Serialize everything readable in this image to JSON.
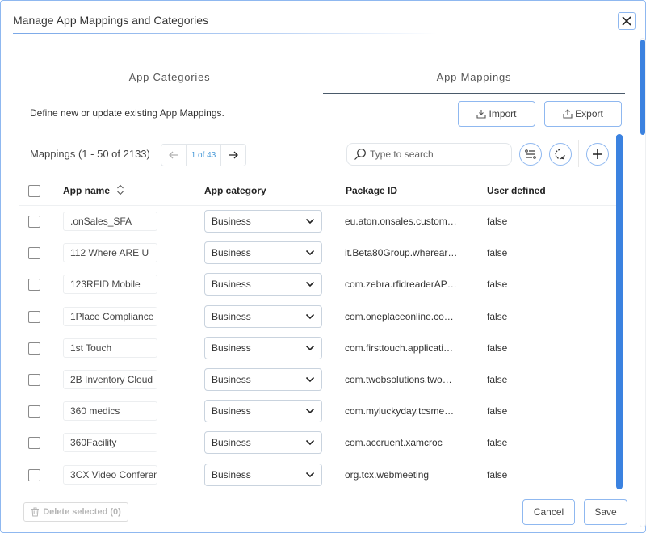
{
  "dialog": {
    "title": "Manage App Mappings and Categories",
    "close_icon": "close-icon"
  },
  "tabs": [
    {
      "label": "App Categories",
      "active": false
    },
    {
      "label": "App Mappings",
      "active": true
    }
  ],
  "description": "Define new or update existing App Mappings.",
  "toolbar": {
    "import_label": "Import",
    "export_label": "Export",
    "mappings_label": "Mappings (1 - 50 of 2133)",
    "page_indicator": "1 of 43",
    "search_placeholder": "Type to search",
    "icons": [
      "filter-icon",
      "refresh-icon",
      "add-icon"
    ]
  },
  "table": {
    "columns": [
      "App name",
      "App category",
      "Package ID",
      "User defined"
    ],
    "rows": [
      {
        "name": ".onSales_SFA",
        "category": "Business",
        "package": "eu.aton.onsales.custom…",
        "user_defined": "false"
      },
      {
        "name": "112 Where ARE U",
        "category": "Business",
        "package": "it.Beta80Group.wherear…",
        "user_defined": "false"
      },
      {
        "name": "123RFID Mobile",
        "category": "Business",
        "package": "com.zebra.rfidreaderAP…",
        "user_defined": "false"
      },
      {
        "name": "1Place Compliance",
        "category": "Business",
        "package": "com.oneplaceonline.co…",
        "user_defined": "false"
      },
      {
        "name": "1st Touch",
        "category": "Business",
        "package": "com.firsttouch.applicati…",
        "user_defined": "false"
      },
      {
        "name": "2B Inventory Cloud",
        "category": "Business",
        "package": "com.twobsolutions.two…",
        "user_defined": "false"
      },
      {
        "name": "360 medics",
        "category": "Business",
        "package": "com.myluckyday.tcsme…",
        "user_defined": "false"
      },
      {
        "name": "360Facility",
        "category": "Business",
        "package": "com.accruent.xamcroc",
        "user_defined": "false"
      },
      {
        "name": "3CX Video Conferen",
        "category": "Business",
        "package": "org.tcx.webmeeting",
        "user_defined": "false"
      }
    ]
  },
  "footer": {
    "delete_label": "Delete selected (0)",
    "cancel_label": "Cancel",
    "save_label": "Save"
  },
  "colors": {
    "accent": "#3b82e0",
    "border_accent": "#8fb8f0",
    "pager_text": "#4a9ad8"
  }
}
